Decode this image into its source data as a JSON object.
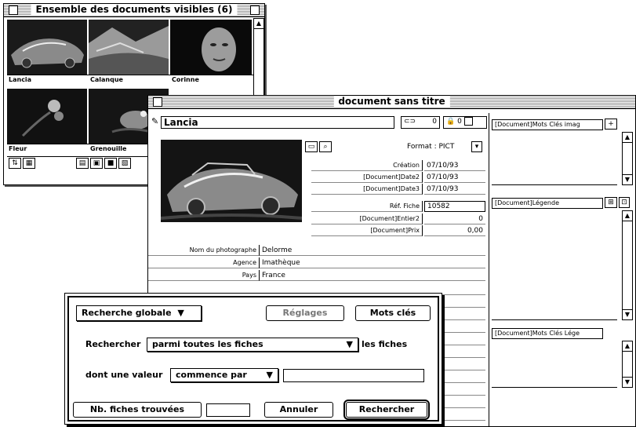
{
  "set_window": {
    "title": "Ensemble des documents visibles (6)",
    "thumbnails": [
      {
        "label": "Lancia"
      },
      {
        "label": "Calanque"
      },
      {
        "label": "Corinne"
      },
      {
        "label": "Fleur"
      },
      {
        "label": "Grenouille"
      },
      {
        "label": ""
      }
    ]
  },
  "doc_window": {
    "title": "document sans titre",
    "doc_name": "Lancia",
    "counter_a": "0",
    "counter_b": "0",
    "format_label": "Format : PICT",
    "dates": [
      {
        "label": "Création",
        "value": "07/10/93"
      },
      {
        "label": "[Document]Date2",
        "value": "07/10/93"
      },
      {
        "label": "[Document]Date3",
        "value": "07/10/93"
      }
    ],
    "ref_fiche": {
      "label": "Réf. Fiche",
      "value": "10582"
    },
    "entier2": {
      "label": "[Document]Entier2",
      "value": "0"
    },
    "prix": {
      "label": "[Document]Prix",
      "value": "0,00"
    },
    "info_rows": [
      {
        "label": "Nom du photographe",
        "value": "Delorme"
      },
      {
        "label": "Agence",
        "value": "Imathèque"
      },
      {
        "label": "Pays",
        "value": "France"
      }
    ],
    "keywords_img_label": "[Document]Mots Clés imag",
    "legend_label": "[Document]Légende",
    "keywords_leg_label": "[Document]Mots Clés Lége"
  },
  "search_dialog": {
    "scope_popup": "Recherche globale",
    "settings_button": "Réglages",
    "keywords_button": "Mots clés",
    "search_label": "Rechercher",
    "search_in_popup": "parmi toutes les fiches",
    "after_popup_text": "les fiches",
    "value_label": "dont une valeur",
    "operator_popup": "commence par",
    "value_input": "",
    "found_button": "Nb. fiches trouvées",
    "found_count": "",
    "cancel_button": "Annuler",
    "search_button": "Rechercher"
  },
  "colors": {
    "text": "#000000",
    "background": "#ffffff",
    "stripe": "#9a9a9a"
  }
}
